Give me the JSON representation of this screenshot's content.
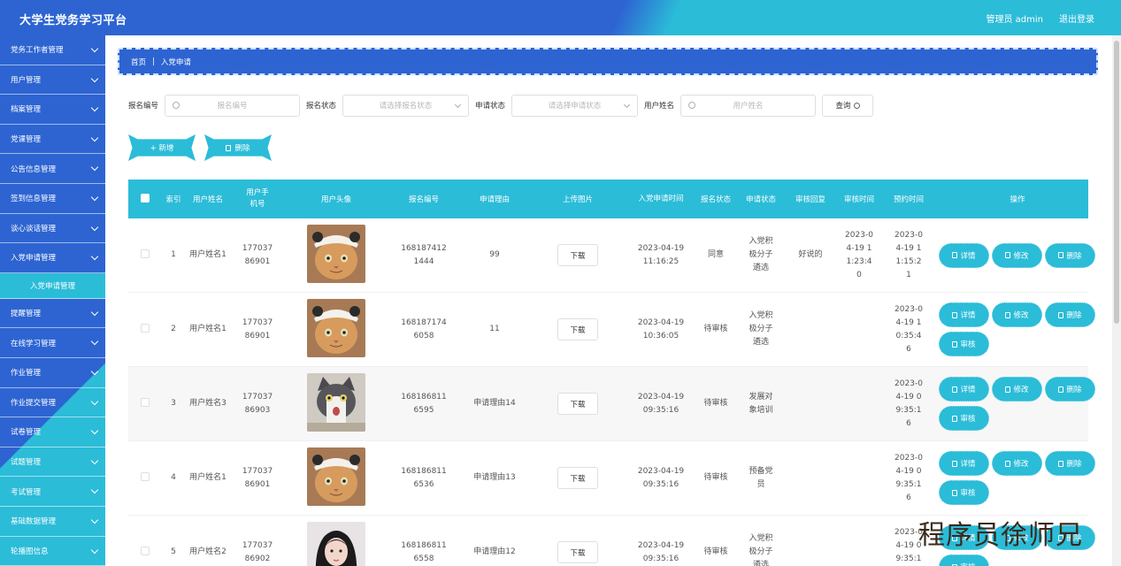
{
  "header": {
    "title": "大学生党务学习平台",
    "user": "管理员 admin",
    "logout": "退出登录"
  },
  "sidebar": {
    "items": [
      {
        "label": "党务工作者管理"
      },
      {
        "label": "用户管理"
      },
      {
        "label": "档案管理"
      },
      {
        "label": "党课管理"
      },
      {
        "label": "公告信息管理"
      },
      {
        "label": "签到信息管理"
      },
      {
        "label": "谈心谈话管理"
      },
      {
        "label": "入党申请管理"
      }
    ],
    "active_sub": "入党申请管理",
    "items_after": [
      {
        "label": "提醒管理"
      },
      {
        "label": "在线学习管理"
      },
      {
        "label": "作业管理"
      },
      {
        "label": "作业提交管理"
      },
      {
        "label": "试卷管理"
      },
      {
        "label": "试题管理"
      },
      {
        "label": "考试管理"
      },
      {
        "label": "基础数据管理"
      },
      {
        "label": "轮播图信息"
      }
    ]
  },
  "breadcrumb": {
    "home": "首页",
    "separator": "|",
    "current": "入党申请"
  },
  "filters": {
    "f1_label": "报名编号",
    "f1_placeholder": "报名编号",
    "f2_label": "报名状态",
    "f2_placeholder": "请选择报名状态",
    "f3_label": "申请状态",
    "f3_placeholder": "请选择申请状态",
    "f4_label": "用户姓名",
    "f4_placeholder": "用户姓名",
    "query": "查询"
  },
  "actions": {
    "add": "+ 新增",
    "delete": "删除"
  },
  "table": {
    "headers": [
      "索引",
      "用户姓名",
      "用户手机号",
      "用户头像",
      "报名编号",
      "申请理由",
      "上传图片",
      "入党申请时间",
      "报名状态",
      "申请状态",
      "审核回复",
      "审核时间",
      "预约时间",
      "操作"
    ],
    "download": "下载",
    "ops": {
      "detail": "详情",
      "edit": "修改",
      "delete": "删除",
      "review": "审核"
    },
    "rows": [
      {
        "idx": "1",
        "name": "用户姓名1",
        "phone": "17703786901",
        "avatar": "cat-hat",
        "code": "1681874121444",
        "reason": "99",
        "apply_time": "2023-04-19 11:16:25",
        "reg_status": "同意",
        "app_status": "入党积极分子遴选",
        "reply": "好说的",
        "review_time": "2023-04-19 11:23:40",
        "book_time": "2023-04-19 11:15:21",
        "review_btn": false
      },
      {
        "idx": "2",
        "name": "用户姓名1",
        "phone": "17703786901",
        "avatar": "cat-hat",
        "code": "1681871746058",
        "reason": "11",
        "apply_time": "2023-04-19 10:36:05",
        "reg_status": "待审核",
        "app_status": "入党积极分子遴选",
        "reply": "",
        "review_time": "",
        "book_time": "2023-04-19 10:35:46",
        "review_btn": true
      },
      {
        "idx": "3",
        "name": "用户姓名3",
        "phone": "17703786903",
        "avatar": "cat-gray",
        "code": "1681868116595",
        "reason": "申请理由14",
        "apply_time": "2023-04-19 09:35:16",
        "reg_status": "待审核",
        "app_status": "发展对象培训",
        "reply": "",
        "review_time": "",
        "book_time": "2023-04-19 09:35:16",
        "review_btn": true
      },
      {
        "idx": "4",
        "name": "用户姓名1",
        "phone": "17703786901",
        "avatar": "cat-hat",
        "code": "1681868116536",
        "reason": "申请理由13",
        "apply_time": "2023-04-19 09:35:16",
        "reg_status": "待审核",
        "app_status": "预备党员",
        "reply": "",
        "review_time": "",
        "book_time": "2023-04-19 09:35:16",
        "review_btn": true
      },
      {
        "idx": "5",
        "name": "用户姓名2",
        "phone": "17703786902",
        "avatar": "girl",
        "code": "1681868116558",
        "reason": "申请理由12",
        "apply_time": "2023-04-19 09:35:16",
        "reg_status": "待审核",
        "app_status": "入党积极分子遴选",
        "reply": "",
        "review_time": "",
        "book_time": "2023-04-19 09:35:16",
        "review_btn": true
      }
    ]
  },
  "watermark": "程序员徐师兄",
  "colors": {
    "primary": "#2d64d2",
    "accent": "#2bbcd8"
  }
}
